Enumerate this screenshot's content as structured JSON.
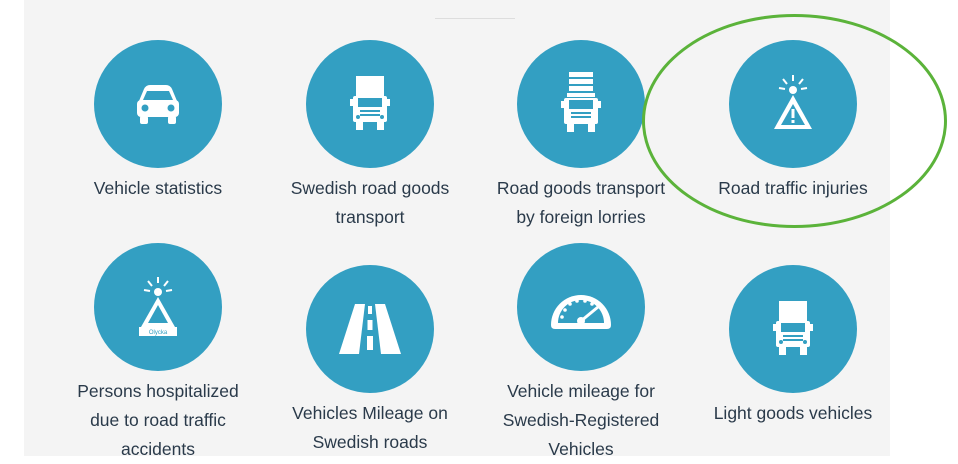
{
  "colors": {
    "circle": "#339fc2",
    "highlight": "#5bb33a",
    "text": "#2a3a4a",
    "panel": "#f4f4f4"
  },
  "tiles": [
    {
      "label_lines": [
        "Vehicle statistics"
      ],
      "icon": "car-icon"
    },
    {
      "label_lines": [
        "Swedish road goods",
        "transport"
      ],
      "icon": "truck-icon"
    },
    {
      "label_lines": [
        "Road goods transport",
        "by foreign lorries"
      ],
      "icon": "lorry-icon"
    },
    {
      "label_lines": [
        "Road traffic injuries"
      ],
      "icon": "warning-sign-icon"
    },
    {
      "label_lines": [
        "Persons hospitalized",
        "due to road traffic",
        "accidents"
      ],
      "icon": "accident-sign-icon",
      "icon_text": "Olycka"
    },
    {
      "label_lines": [
        "Vehicles Mileage on",
        "Swedish roads"
      ],
      "icon": "road-icon"
    },
    {
      "label_lines": [
        "Vehicle mileage for",
        "Swedish-Registered",
        "Vehicles"
      ],
      "icon": "speedometer-icon"
    },
    {
      "label_lines": [
        "Light goods vehicles"
      ],
      "icon": "van-icon"
    }
  ],
  "highlighted_tile": "Road traffic injuries"
}
